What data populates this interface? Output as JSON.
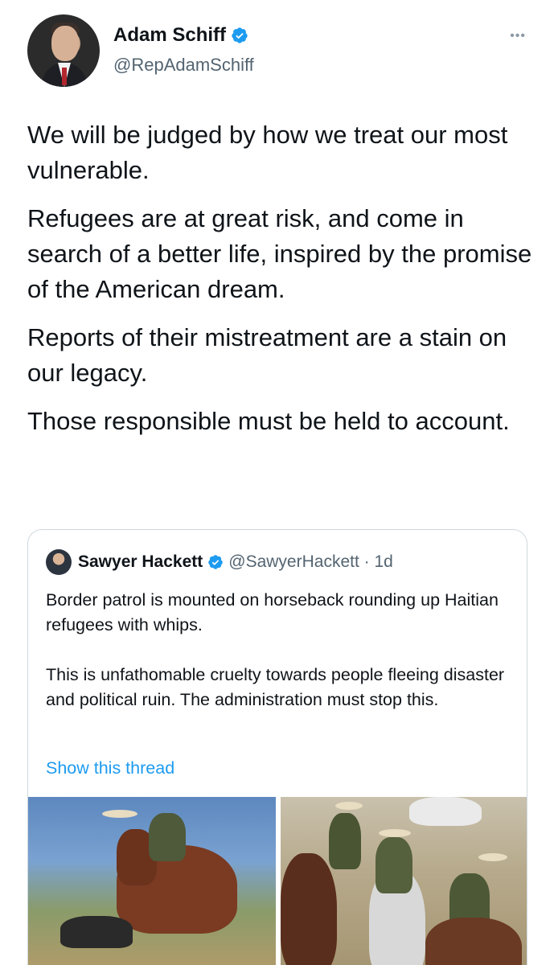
{
  "author": {
    "display_name": "Adam Schiff",
    "handle": "@RepAdamSchiff",
    "verified_icon": "verified-badge-icon",
    "more_icon": "ellipsis-icon"
  },
  "tweet": {
    "paragraphs": [
      "We will be judged by how we treat our most vulnerable.",
      "Refugees are at great risk, and come in search of a better life, inspired by the promise of the American dream.",
      "Reports of their mistreatment are a stain on our legacy.",
      "Those responsible must be held to account."
    ]
  },
  "quoted": {
    "display_name": "Sawyer Hackett",
    "handle": "@SawyerHackett",
    "separator": " · ",
    "time": "1d",
    "paragraphs": [
      "Border patrol is mounted on horseback rounding up Haitian refugees with whips.",
      "This is unfathomable cruelty towards people fleeing disaster and political ruin. The administration must stop this."
    ],
    "show_thread": "Show this thread"
  },
  "colors": {
    "link": "#1d9bf0",
    "verified": "#1d9bf0",
    "secondary_text": "#536471",
    "border": "#cfd9de"
  }
}
